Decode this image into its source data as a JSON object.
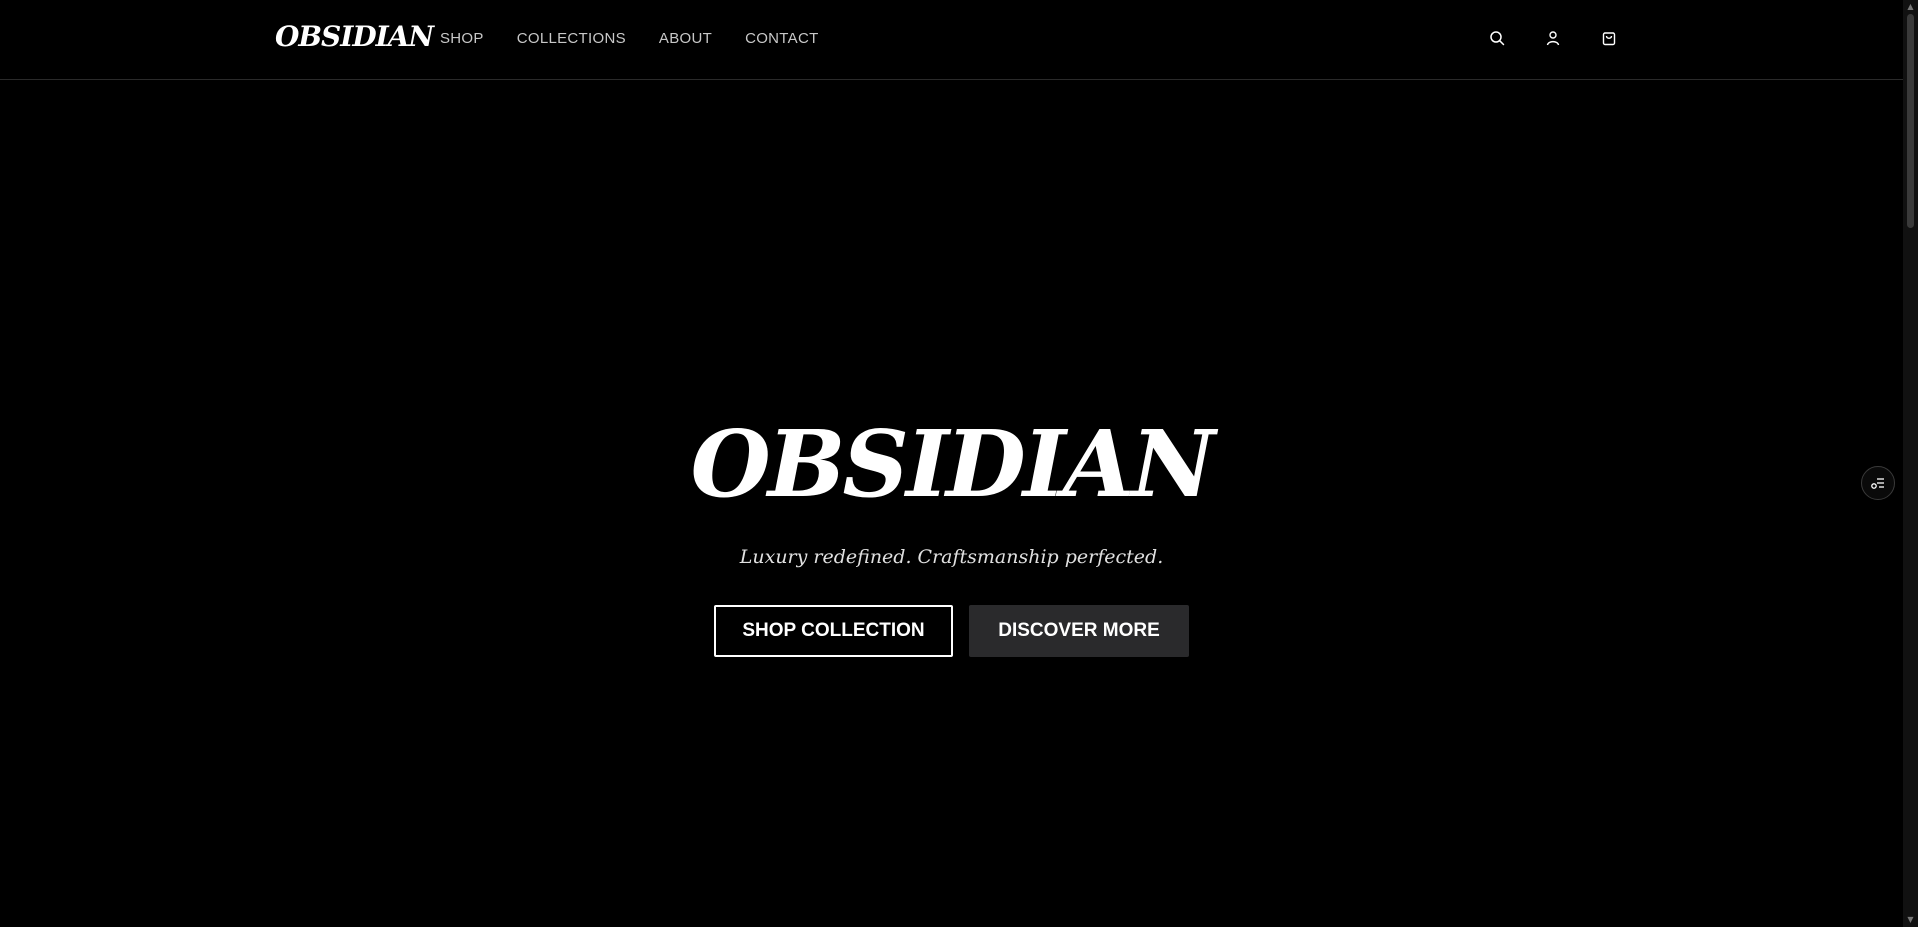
{
  "header": {
    "logo": "OBSIDIAN",
    "nav": [
      "SHOP",
      "COLLECTIONS",
      "ABOUT",
      "CONTACT"
    ],
    "icons": [
      "search-icon",
      "user-icon",
      "shopping-bag-icon"
    ]
  },
  "hero": {
    "title": "OBSIDIAN",
    "subtitle": "Luxury redefined. Craftsmanship perfected.",
    "primary_button": "SHOP COLLECTION",
    "secondary_button": "DISCOVER MORE"
  },
  "side_widget": {
    "icon": "settings-toggle-icon"
  },
  "colors": {
    "background": "#000000",
    "text": "#ffffff",
    "nav_text": "#c8c8c8",
    "secondary_button_bg": "#2a2a2c"
  }
}
